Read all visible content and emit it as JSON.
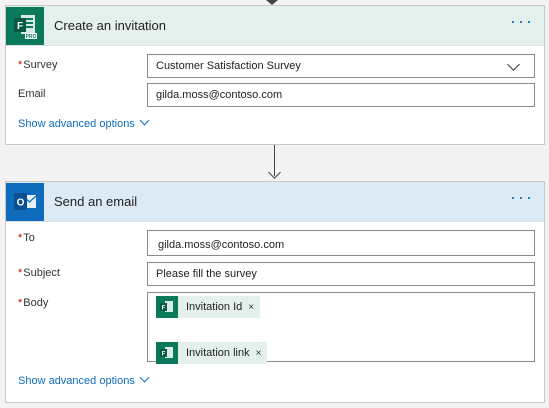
{
  "create_invitation": {
    "title": "Create an invitation",
    "more": "···",
    "survey": {
      "label": "Survey",
      "value": "Customer Satisfaction Survey"
    },
    "email": {
      "label": "Email",
      "value": "gilda.moss@contoso.com"
    },
    "advanced": "Show advanced options"
  },
  "send_email": {
    "title": "Send an email",
    "more": "···",
    "to": {
      "label": "To",
      "value": "gilda.moss@contoso.com"
    },
    "subject": {
      "label": "Subject",
      "value": "Please fill the survey"
    },
    "body": {
      "label": "Body",
      "tokens": [
        "Invitation Id",
        "Invitation link"
      ],
      "remove": "×"
    },
    "advanced": "Show advanced options"
  },
  "icons": {
    "forms_letter": "F",
    "outlook_letter": "O",
    "forms_badge": "PRO"
  },
  "colors": {
    "forms_green": "#0a7a5b",
    "outlook_blue": "#0f6cbd",
    "required": "#cc0000",
    "link": "#0f6cbd"
  }
}
